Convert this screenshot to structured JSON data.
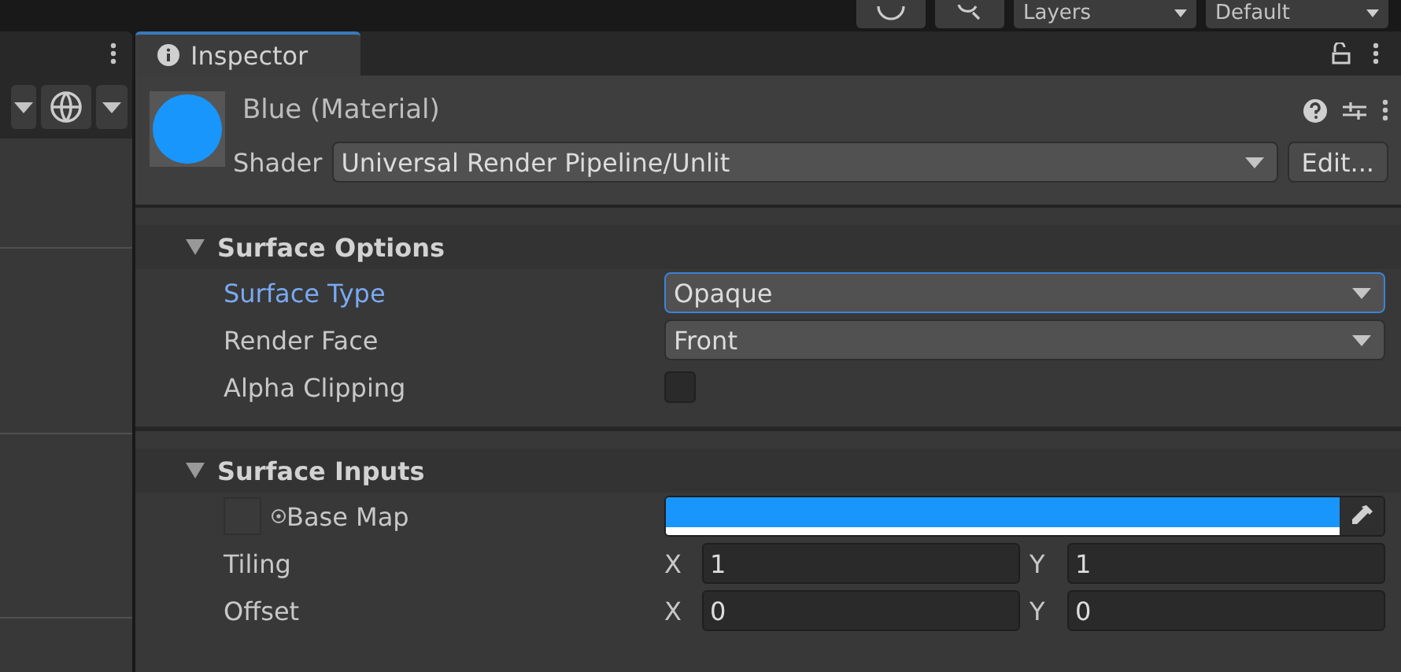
{
  "toolbar": {
    "dropdowns": [
      "Layers",
      "Default"
    ]
  },
  "inspector": {
    "tab": "Inspector",
    "material": {
      "name": "Blue (Material)"
    },
    "shader": {
      "label": "Shader",
      "value": "Universal Render Pipeline/Unlit",
      "edit": "Edit..."
    },
    "sections": [
      {
        "title": "Surface Options",
        "expanded": true,
        "rows": [
          {
            "kind": "dropdown",
            "label": "Surface Type",
            "value": "Opaque",
            "focused": true
          },
          {
            "kind": "dropdown",
            "label": "Render Face",
            "value": "Front",
            "focused": false
          },
          {
            "kind": "checkbox",
            "label": "Alpha Clipping",
            "checked": false
          }
        ]
      },
      {
        "title": "Surface Inputs",
        "expanded": true,
        "rows": [
          {
            "kind": "texture",
            "label": "Base Map"
          },
          {
            "kind": "vector",
            "label": "Tiling",
            "axes": [
              {
                "label": "X",
                "value": "1"
              },
              {
                "label": "Y",
                "value": "1"
              }
            ]
          },
          {
            "kind": "vector",
            "label": "Offset",
            "axes": [
              {
                "label": "X",
                "value": "0"
              },
              {
                "label": "Y",
                "value": "0"
              }
            ]
          }
        ]
      }
    ]
  }
}
